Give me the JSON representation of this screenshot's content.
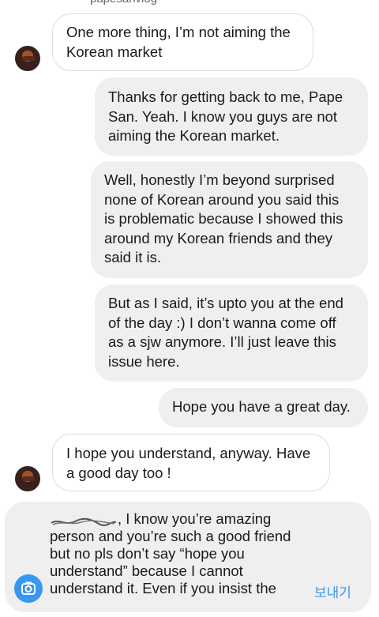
{
  "header": {
    "username": "papesanvlog"
  },
  "messages": [
    {
      "side": "in",
      "text_lines": [
        "One more thing, I’m not aiming the",
        "Korean market"
      ]
    },
    {
      "side": "out",
      "text_lines": [
        "Thanks for getting back to me, Pape",
        "San. Yeah. I know you guys are not",
        "aiming the Korean market."
      ]
    },
    {
      "side": "out",
      "text_lines": [
        "Well, honestly I’m beyond surprised",
        "none of Korean around you said this",
        "is problematic because I showed this",
        "around my Korean friends and they",
        "said it is."
      ]
    },
    {
      "side": "out",
      "text_lines": [
        "But as I said, it’s upto you at the end",
        "of the day :) I don’t wanna come off",
        "as a sjw anymore. I’ll just leave this",
        "issue here."
      ]
    },
    {
      "side": "out",
      "text_lines": [
        "Hope you have a great day."
      ]
    },
    {
      "side": "in",
      "text_lines": [
        "I hope you understand, anyway. Have",
        "a good day too !"
      ]
    }
  ],
  "composer": {
    "draft_lines": [
      ", I know you’re amazing",
      "person and you’re such a good friend",
      "but no pls don’t say “hope you",
      "understand” because I cannot",
      "understand it. Even if you insist the"
    ],
    "send_label": "보내기",
    "camera_icon": "camera-icon"
  },
  "colors": {
    "outgoing_bubble": "#efefef",
    "incoming_border": "#dcdcdc",
    "accent": "#3897f0"
  }
}
